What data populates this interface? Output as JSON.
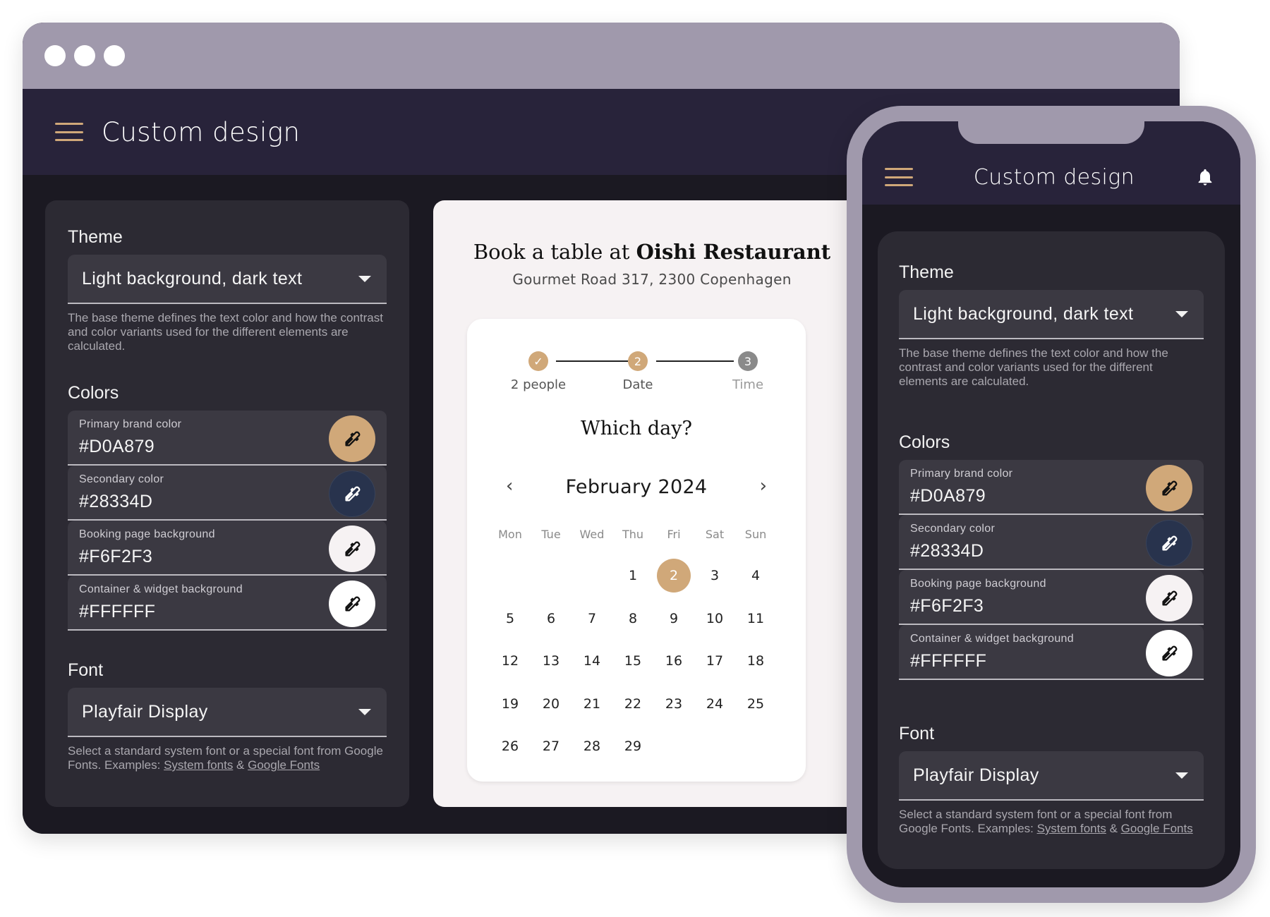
{
  "app": {
    "title": "Custom design"
  },
  "settings": {
    "theme": {
      "title": "Theme",
      "selected": "Light background, dark text",
      "helper": "The base theme defines the text color and how the contrast and color variants used for the different elements are calculated."
    },
    "colors": {
      "title": "Colors",
      "fields": [
        {
          "label": "Primary brand color",
          "value": "#D0A879",
          "swatch": "#D0A879",
          "icon": "eyedropper-icon"
        },
        {
          "label": "Secondary color",
          "value": "#28334D",
          "swatch": "#28334D",
          "icon": "eyedropper-icon"
        },
        {
          "label": "Booking page background",
          "value": "#F6F2F3",
          "swatch": "#F6F2F3",
          "icon": "eyedropper-icon"
        },
        {
          "label": "Container & widget background",
          "value": "#FFFFFF",
          "swatch": "#FFFFFF",
          "icon": "eyedropper-icon"
        }
      ]
    },
    "font": {
      "title": "Font",
      "selected": "Playfair Display",
      "helper_prefix": "Select a standard system font or a special font from Google Fonts. Examples: ",
      "link_system": "System fonts",
      "separator": " & ",
      "link_google": "Google Fonts"
    }
  },
  "booking": {
    "title_prefix": "Book a table at ",
    "restaurant": "Oishi Restaurant",
    "address": "Gourmet Road 317, 2300 Copenhagen",
    "steps": [
      {
        "label": "2 people",
        "state": "done",
        "marker": "✓"
      },
      {
        "label": "Date",
        "state": "active",
        "marker": "2"
      },
      {
        "label": "Time",
        "state": "pending",
        "marker": "3"
      }
    ],
    "question": "Which day?",
    "month": "February 2024",
    "prev_icon": "‹",
    "next_icon": "›",
    "weekdays": [
      "Mon",
      "Tue",
      "Wed",
      "Thu",
      "Fri",
      "Sat",
      "Sun"
    ],
    "weeks": [
      [
        "",
        "",
        "",
        "1",
        "2",
        "3",
        "4"
      ],
      [
        "5",
        "6",
        "7",
        "8",
        "9",
        "10",
        "11"
      ],
      [
        "12",
        "13",
        "14",
        "15",
        "16",
        "17",
        "18"
      ],
      [
        "19",
        "20",
        "21",
        "22",
        "23",
        "24",
        "25"
      ],
      [
        "26",
        "27",
        "28",
        "29",
        "",
        "",
        ""
      ]
    ],
    "selected_day": "2"
  },
  "colors": {
    "accent": "#D0A879",
    "header_bg": "#28233A",
    "frame": "#A099AC",
    "step_pending": "#8A8A8A"
  }
}
